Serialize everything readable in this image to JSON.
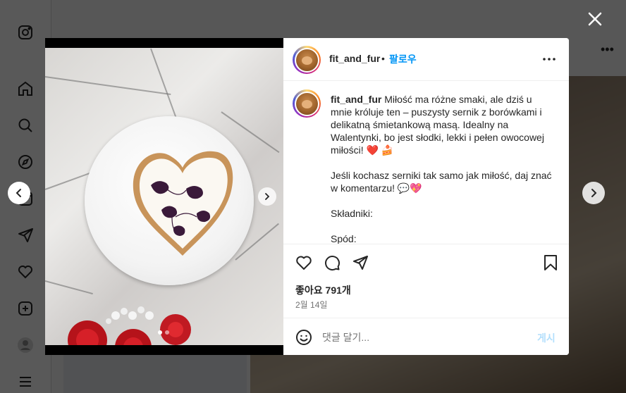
{
  "sidebar": {
    "items": [
      {
        "icon": "instagram-logo-icon"
      },
      {
        "icon": "home-icon"
      },
      {
        "icon": "search-icon"
      },
      {
        "icon": "explore-icon"
      },
      {
        "icon": "reels-icon"
      },
      {
        "icon": "messages-icon"
      },
      {
        "icon": "notifications-icon"
      },
      {
        "icon": "create-icon"
      },
      {
        "icon": "profile-icon"
      },
      {
        "icon": "more-menu-icon"
      }
    ]
  },
  "post": {
    "header": {
      "username": "fit_and_fur",
      "separator": "•",
      "follow_label": "팔로우"
    },
    "caption": {
      "username": "fit_and_fur",
      "text": "Miłość ma różne smaki, ale dziś u mnie króluje ten – puszysty sernik z borówkami i delikatną śmietankową masą. Idealny na Walentynki, bo jest słodki, lekki i pełen owocowej miłości! ❤️ 🍰\n\nJeśli kochasz serniki tak samo jak miłość, daj znać w komentarzu! 💬💖\n\nSkładniki:\n\nSpód:"
    },
    "likes": "좋아요 791개",
    "date": "2월 14일",
    "comment": {
      "placeholder": "댓글 달기...",
      "post_label": "게시"
    },
    "carousel": {
      "total": 2,
      "current": 1
    }
  },
  "colors": {
    "accent": "#0095f6",
    "post_disabled": "#b2dffc",
    "overlay": "rgba(0,0,0,0.65)",
    "like_heart": "#ed4956"
  }
}
